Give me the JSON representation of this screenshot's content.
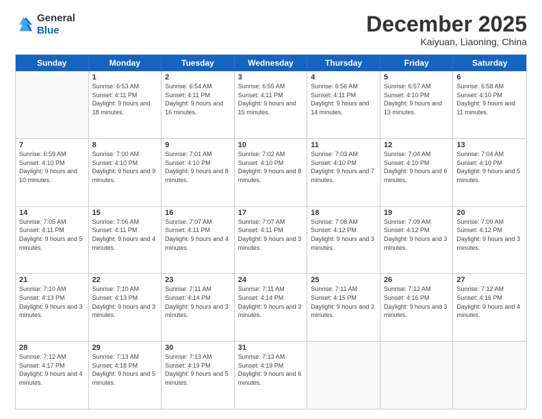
{
  "header": {
    "logo": {
      "line1": "General",
      "line2": "Blue"
    },
    "title": "December 2025",
    "subtitle": "Kaiyuan, Liaoning, China"
  },
  "days": [
    "Sunday",
    "Monday",
    "Tuesday",
    "Wednesday",
    "Thursday",
    "Friday",
    "Saturday"
  ],
  "weeks": [
    [
      {
        "day": "",
        "empty": true
      },
      {
        "day": "1",
        "sunrise": "Sunrise: 6:53 AM",
        "sunset": "Sunset: 4:11 PM",
        "daylight": "Daylight: 9 hours and 18 minutes."
      },
      {
        "day": "2",
        "sunrise": "Sunrise: 6:54 AM",
        "sunset": "Sunset: 4:11 PM",
        "daylight": "Daylight: 9 hours and 16 minutes."
      },
      {
        "day": "3",
        "sunrise": "Sunrise: 6:55 AM",
        "sunset": "Sunset: 4:11 PM",
        "daylight": "Daylight: 9 hours and 15 minutes."
      },
      {
        "day": "4",
        "sunrise": "Sunrise: 6:56 AM",
        "sunset": "Sunset: 4:11 PM",
        "daylight": "Daylight: 9 hours and 14 minutes."
      },
      {
        "day": "5",
        "sunrise": "Sunrise: 6:57 AM",
        "sunset": "Sunset: 4:10 PM",
        "daylight": "Daylight: 9 hours and 13 minutes."
      },
      {
        "day": "6",
        "sunrise": "Sunrise: 6:58 AM",
        "sunset": "Sunset: 4:10 PM",
        "daylight": "Daylight: 9 hours and 11 minutes."
      }
    ],
    [
      {
        "day": "7",
        "sunrise": "Sunrise: 6:59 AM",
        "sunset": "Sunset: 4:10 PM",
        "daylight": "Daylight: 9 hours and 10 minutes."
      },
      {
        "day": "8",
        "sunrise": "Sunrise: 7:00 AM",
        "sunset": "Sunset: 4:10 PM",
        "daylight": "Daylight: 9 hours and 9 minutes."
      },
      {
        "day": "9",
        "sunrise": "Sunrise: 7:01 AM",
        "sunset": "Sunset: 4:10 PM",
        "daylight": "Daylight: 9 hours and 8 minutes."
      },
      {
        "day": "10",
        "sunrise": "Sunrise: 7:02 AM",
        "sunset": "Sunset: 4:10 PM",
        "daylight": "Daylight: 9 hours and 8 minutes."
      },
      {
        "day": "11",
        "sunrise": "Sunrise: 7:03 AM",
        "sunset": "Sunset: 4:10 PM",
        "daylight": "Daylight: 9 hours and 7 minutes."
      },
      {
        "day": "12",
        "sunrise": "Sunrise: 7:04 AM",
        "sunset": "Sunset: 4:10 PM",
        "daylight": "Daylight: 9 hours and 6 minutes."
      },
      {
        "day": "13",
        "sunrise": "Sunrise: 7:04 AM",
        "sunset": "Sunset: 4:10 PM",
        "daylight": "Daylight: 9 hours and 5 minutes."
      }
    ],
    [
      {
        "day": "14",
        "sunrise": "Sunrise: 7:05 AM",
        "sunset": "Sunset: 4:11 PM",
        "daylight": "Daylight: 9 hours and 5 minutes."
      },
      {
        "day": "15",
        "sunrise": "Sunrise: 7:06 AM",
        "sunset": "Sunset: 4:11 PM",
        "daylight": "Daylight: 9 hours and 4 minutes."
      },
      {
        "day": "16",
        "sunrise": "Sunrise: 7:07 AM",
        "sunset": "Sunset: 4:11 PM",
        "daylight": "Daylight: 9 hours and 4 minutes."
      },
      {
        "day": "17",
        "sunrise": "Sunrise: 7:07 AM",
        "sunset": "Sunset: 4:11 PM",
        "daylight": "Daylight: 9 hours and 3 minutes."
      },
      {
        "day": "18",
        "sunrise": "Sunrise: 7:08 AM",
        "sunset": "Sunset: 4:12 PM",
        "daylight": "Daylight: 9 hours and 3 minutes."
      },
      {
        "day": "19",
        "sunrise": "Sunrise: 7:09 AM",
        "sunset": "Sunset: 4:12 PM",
        "daylight": "Daylight: 9 hours and 3 minutes."
      },
      {
        "day": "20",
        "sunrise": "Sunrise: 7:09 AM",
        "sunset": "Sunset: 4:12 PM",
        "daylight": "Daylight: 9 hours and 3 minutes."
      }
    ],
    [
      {
        "day": "21",
        "sunrise": "Sunrise: 7:10 AM",
        "sunset": "Sunset: 4:13 PM",
        "daylight": "Daylight: 9 hours and 3 minutes."
      },
      {
        "day": "22",
        "sunrise": "Sunrise: 7:10 AM",
        "sunset": "Sunset: 4:13 PM",
        "daylight": "Daylight: 9 hours and 3 minutes."
      },
      {
        "day": "23",
        "sunrise": "Sunrise: 7:11 AM",
        "sunset": "Sunset: 4:14 PM",
        "daylight": "Daylight: 9 hours and 3 minutes."
      },
      {
        "day": "24",
        "sunrise": "Sunrise: 7:11 AM",
        "sunset": "Sunset: 4:14 PM",
        "daylight": "Daylight: 9 hours and 3 minutes."
      },
      {
        "day": "25",
        "sunrise": "Sunrise: 7:11 AM",
        "sunset": "Sunset: 4:15 PM",
        "daylight": "Daylight: 9 hours and 3 minutes."
      },
      {
        "day": "26",
        "sunrise": "Sunrise: 7:12 AM",
        "sunset": "Sunset: 4:16 PM",
        "daylight": "Daylight: 9 hours and 3 minutes."
      },
      {
        "day": "27",
        "sunrise": "Sunrise: 7:12 AM",
        "sunset": "Sunset: 4:16 PM",
        "daylight": "Daylight: 9 hours and 4 minutes."
      }
    ],
    [
      {
        "day": "28",
        "sunrise": "Sunrise: 7:12 AM",
        "sunset": "Sunset: 4:17 PM",
        "daylight": "Daylight: 9 hours and 4 minutes."
      },
      {
        "day": "29",
        "sunrise": "Sunrise: 7:13 AM",
        "sunset": "Sunset: 4:18 PM",
        "daylight": "Daylight: 9 hours and 5 minutes."
      },
      {
        "day": "30",
        "sunrise": "Sunrise: 7:13 AM",
        "sunset": "Sunset: 4:19 PM",
        "daylight": "Daylight: 9 hours and 5 minutes."
      },
      {
        "day": "31",
        "sunrise": "Sunrise: 7:13 AM",
        "sunset": "Sunset: 4:19 PM",
        "daylight": "Daylight: 9 hours and 6 minutes."
      },
      {
        "day": "",
        "empty": true
      },
      {
        "day": "",
        "empty": true
      },
      {
        "day": "",
        "empty": true
      }
    ]
  ]
}
